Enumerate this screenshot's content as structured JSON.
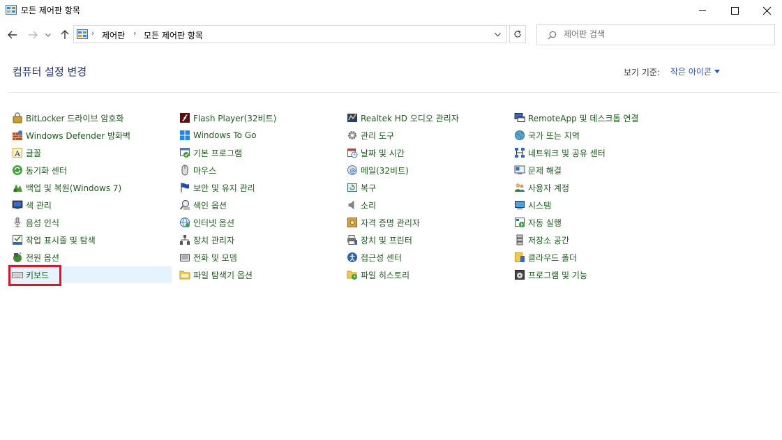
{
  "window": {
    "title": "모든 제어판 항목"
  },
  "address_bar": {
    "crumbs": [
      "제어판",
      "모든 제어판 항목"
    ],
    "separator": "›"
  },
  "search": {
    "placeholder": "제어판 검색"
  },
  "header": {
    "title": "컴퓨터 설정 변경",
    "view_by_label": "보기 기준:",
    "view_by_value": "작은 아이콘"
  },
  "colors": {
    "item_text": "#1a5c1a",
    "heading": "#1e3287",
    "link": "#1e4fc7",
    "selection_box": "#e81123",
    "selected_bg": "#e5f3ff"
  },
  "items": {
    "col1": [
      {
        "label": "BitLocker 드라이브 암호화",
        "icon": "bitlocker-icon"
      },
      {
        "label": "Windows Defender 방화벽",
        "icon": "firewall-icon"
      },
      {
        "label": "글꼴",
        "icon": "fonts-icon"
      },
      {
        "label": "동기화 센터",
        "icon": "sync-center-icon"
      },
      {
        "label": "백업 및 복원(Windows 7)",
        "icon": "backup-restore-icon"
      },
      {
        "label": "색 관리",
        "icon": "color-management-icon"
      },
      {
        "label": "음성 인식",
        "icon": "speech-recognition-icon"
      },
      {
        "label": "작업 표시줄 및 탐색",
        "icon": "taskbar-icon"
      },
      {
        "label": "전원 옵션",
        "icon": "power-options-icon"
      },
      {
        "label": "키보드",
        "icon": "keyboard-icon",
        "selected": true
      }
    ],
    "col2": [
      {
        "label": "Flash Player(32비트)",
        "icon": "flash-player-icon"
      },
      {
        "label": "Windows To Go",
        "icon": "windows-to-go-icon"
      },
      {
        "label": "기본 프로그램",
        "icon": "default-programs-icon"
      },
      {
        "label": "마우스",
        "icon": "mouse-icon"
      },
      {
        "label": "보안 및 유지 관리",
        "icon": "security-maintenance-icon"
      },
      {
        "label": "색인 옵션",
        "icon": "indexing-options-icon"
      },
      {
        "label": "인터넷 옵션",
        "icon": "internet-options-icon"
      },
      {
        "label": "장치 관리자",
        "icon": "device-manager-icon"
      },
      {
        "label": "전화 및 모뎀",
        "icon": "phone-modem-icon"
      },
      {
        "label": "파일 탐색기 옵션",
        "icon": "file-explorer-options-icon"
      }
    ],
    "col3": [
      {
        "label": "Realtek HD 오디오 관리자",
        "icon": "realtek-audio-icon"
      },
      {
        "label": "관리 도구",
        "icon": "admin-tools-icon"
      },
      {
        "label": "날짜 및 시간",
        "icon": "date-time-icon"
      },
      {
        "label": "메일(32비트)",
        "icon": "mail-icon"
      },
      {
        "label": "복구",
        "icon": "recovery-icon"
      },
      {
        "label": "소리",
        "icon": "sound-icon"
      },
      {
        "label": "자격 증명 관리자",
        "icon": "credential-manager-icon"
      },
      {
        "label": "장치 및 프린터",
        "icon": "devices-printers-icon"
      },
      {
        "label": "접근성 센터",
        "icon": "ease-of-access-icon"
      },
      {
        "label": "파일 히스토리",
        "icon": "file-history-icon"
      }
    ],
    "col4": [
      {
        "label": "RemoteApp 및 데스크톱 연결",
        "icon": "remoteapp-icon"
      },
      {
        "label": "국가 또는 지역",
        "icon": "region-icon"
      },
      {
        "label": "네트워크 및 공유 센터",
        "icon": "network-sharing-icon"
      },
      {
        "label": "문제 해결",
        "icon": "troubleshooting-icon"
      },
      {
        "label": "사용자 계정",
        "icon": "user-accounts-icon"
      },
      {
        "label": "시스템",
        "icon": "system-icon"
      },
      {
        "label": "자동 실행",
        "icon": "autoplay-icon"
      },
      {
        "label": "저장소 공간",
        "icon": "storage-spaces-icon"
      },
      {
        "label": "클라우드 폴더",
        "icon": "cloud-folder-icon"
      },
      {
        "label": "프로그램 및 기능",
        "icon": "programs-features-icon"
      }
    ]
  }
}
